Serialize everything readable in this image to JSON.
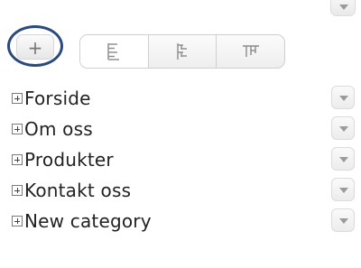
{
  "toolbar": {
    "add_label": "+",
    "align_buttons": [
      {
        "icon": "align-left-icon",
        "active": true
      },
      {
        "icon": "align-center-icon",
        "active": false
      },
      {
        "icon": "align-top-icon",
        "active": false
      }
    ]
  },
  "tree": {
    "items": [
      {
        "label": "Forside"
      },
      {
        "label": "Om oss"
      },
      {
        "label": "Produkter"
      },
      {
        "label": "Kontakt oss"
      },
      {
        "label": "New category"
      }
    ]
  },
  "icons": {
    "dropdown": "chevron-down-icon",
    "expand": "plus-box-icon"
  },
  "colors": {
    "highlight_ring": "#2a4a7f",
    "text": "#222222",
    "button_border": "#cfcfcf"
  }
}
